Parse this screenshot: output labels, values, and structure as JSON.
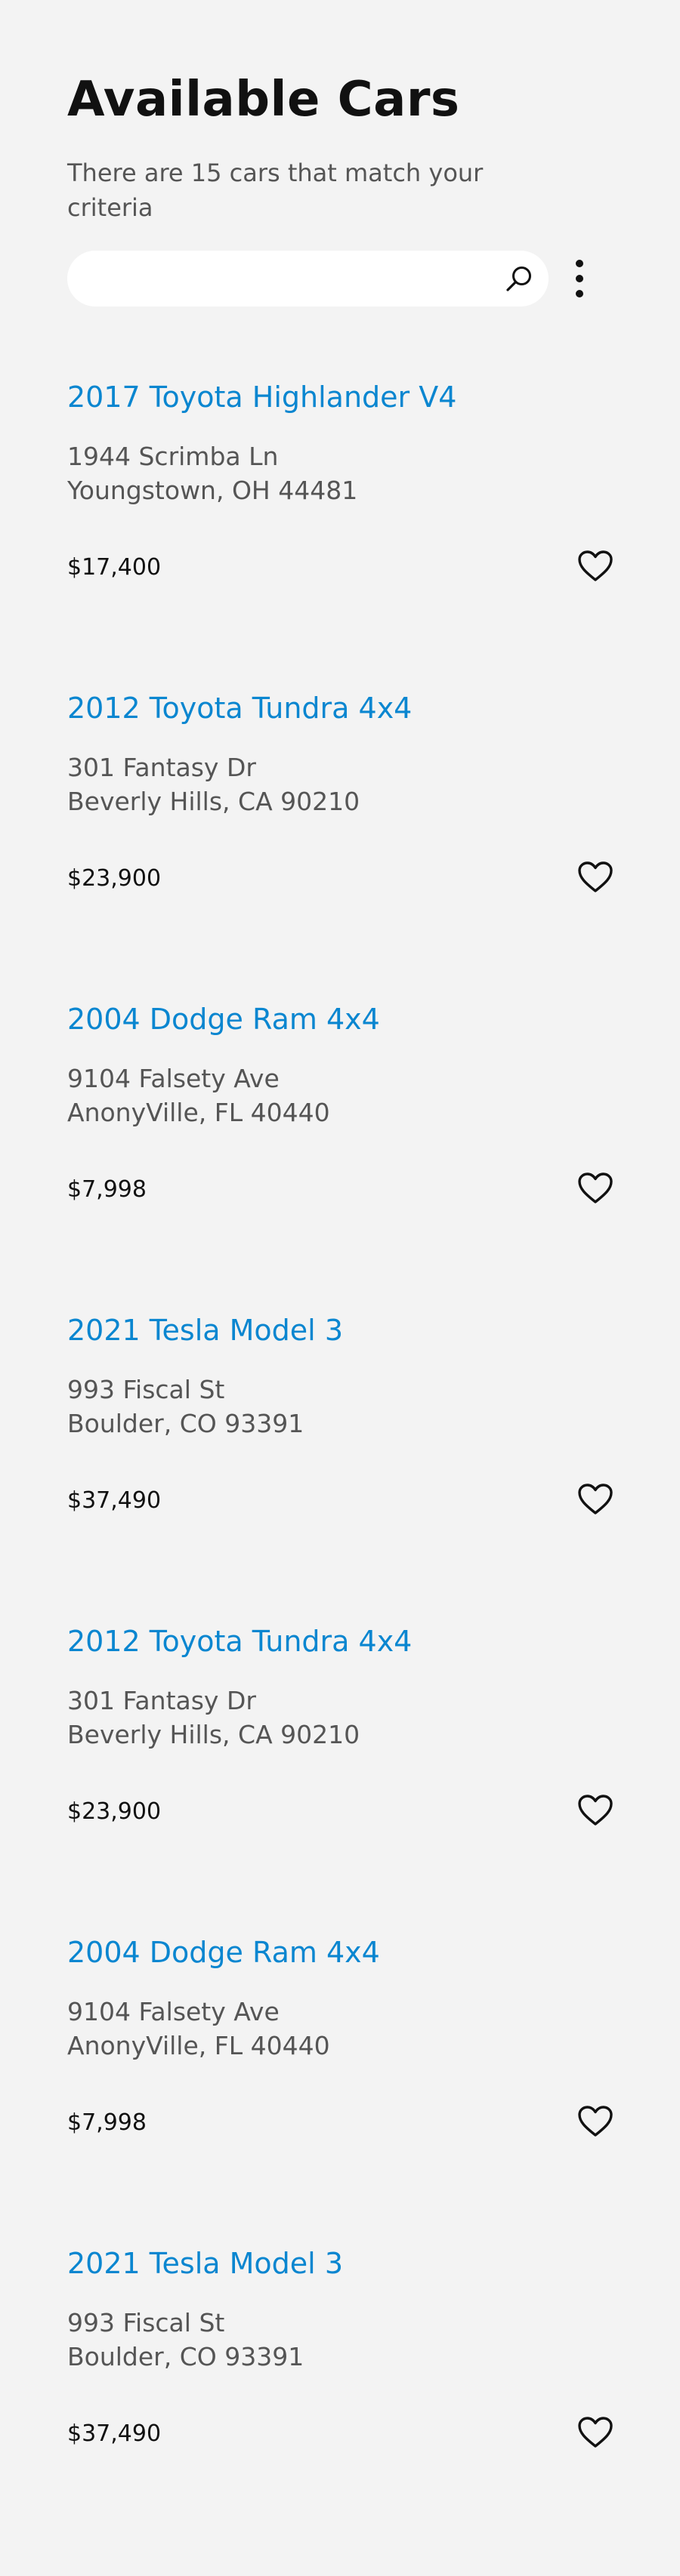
{
  "header": {
    "title": "Available Cars",
    "subtitle": "There are 15 cars that match your criteria"
  },
  "search": {
    "value": "",
    "placeholder": "",
    "icon": "search-icon"
  },
  "menu": {
    "icon": "more-vertical-icon"
  },
  "colors": {
    "background": "#f3f3f3",
    "accent": "#0a86d0",
    "text_primary": "#111111",
    "text_secondary": "#555555"
  },
  "cars": [
    {
      "title": "2017 Toyota Highlander V4",
      "address_line1": "1944 Scrimba Ln",
      "address_line2": "Youngstown, OH 44481",
      "price": "$17,400",
      "favorite_icon": "heart-outline-icon"
    },
    {
      "title": "2012 Toyota Tundra 4x4",
      "address_line1": "301 Fantasy Dr",
      "address_line2": "Beverly Hills, CA 90210",
      "price": "$23,900",
      "favorite_icon": "heart-outline-icon"
    },
    {
      "title": "2004 Dodge Ram 4x4",
      "address_line1": "9104 Falsety Ave",
      "address_line2": "AnonyVille, FL 40440",
      "price": "$7,998",
      "favorite_icon": "heart-outline-icon"
    },
    {
      "title": "2021 Tesla Model 3",
      "address_line1": "993 Fiscal St",
      "address_line2": "Boulder, CO 93391",
      "price": "$37,490",
      "favorite_icon": "heart-outline-icon"
    },
    {
      "title": "2012 Toyota Tundra 4x4",
      "address_line1": "301 Fantasy Dr",
      "address_line2": "Beverly Hills, CA 90210",
      "price": "$23,900",
      "favorite_icon": "heart-outline-icon"
    },
    {
      "title": "2004 Dodge Ram 4x4",
      "address_line1": "9104 Falsety Ave",
      "address_line2": "AnonyVille, FL 40440",
      "price": "$7,998",
      "favorite_icon": "heart-outline-icon"
    },
    {
      "title": "2021 Tesla Model 3",
      "address_line1": "993 Fiscal St",
      "address_line2": "Boulder, CO 93391",
      "price": "$37,490",
      "favorite_icon": "heart-outline-icon"
    }
  ]
}
